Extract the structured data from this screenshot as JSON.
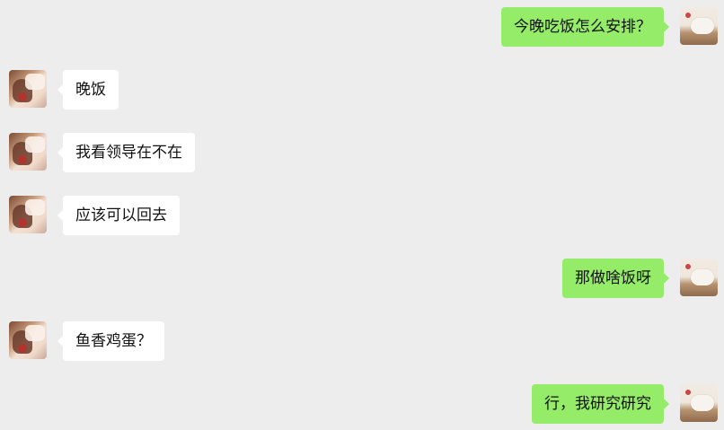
{
  "colors": {
    "background": "#ededed",
    "incoming_bubble": "#ffffff",
    "outgoing_bubble": "#95ec69"
  },
  "messages": [
    {
      "side": "out",
      "text": "今晚吃饭怎么安排？"
    },
    {
      "side": "in",
      "text": "晚饭"
    },
    {
      "side": "in",
      "text": "我看领导在不在"
    },
    {
      "side": "in",
      "text": "应该可以回去"
    },
    {
      "side": "out",
      "text": "那做啥饭呀"
    },
    {
      "side": "in",
      "text": "鱼香鸡蛋？"
    },
    {
      "side": "out",
      "text": "行，我研究研究"
    }
  ]
}
